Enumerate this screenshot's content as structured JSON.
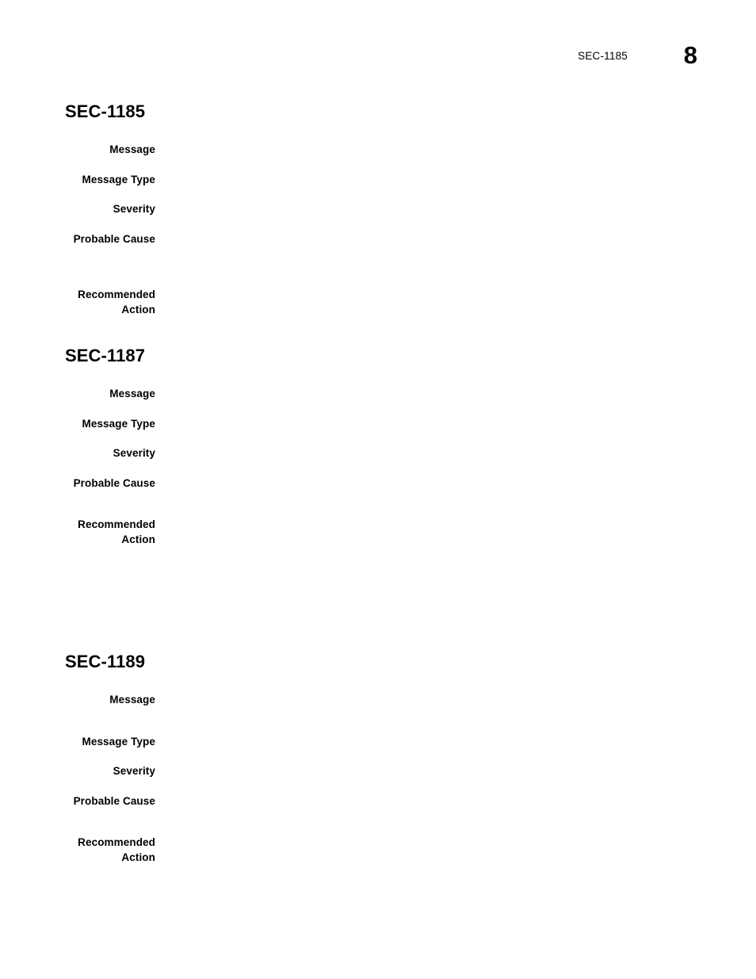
{
  "document": {
    "page_background": "#ffffff",
    "text_color": "#000000"
  },
  "header": {
    "chapter_label": "SEC-1185",
    "page_number": "8"
  },
  "field_labels": {
    "message": "Message",
    "message_type": "Message Type",
    "severity": "Severity",
    "probable_cause": "Probable Cause",
    "recommended_action": "Recommended\nAction"
  },
  "sections": [
    {
      "id": "sec-1185",
      "title": "SEC-1185",
      "fields": [
        {
          "label": "Message",
          "value": ""
        },
        {
          "label": "Message Type",
          "value": ""
        },
        {
          "label": "Severity",
          "value": ""
        },
        {
          "label": "Probable Cause",
          "value": ""
        },
        {
          "label": "Recommended\nAction",
          "value": ""
        }
      ]
    },
    {
      "id": "sec-1187",
      "title": "SEC-1187",
      "fields": [
        {
          "label": "Message",
          "value": ""
        },
        {
          "label": "Message Type",
          "value": ""
        },
        {
          "label": "Severity",
          "value": ""
        },
        {
          "label": "Probable Cause",
          "value": ""
        },
        {
          "label": "Recommended\nAction",
          "value": ""
        }
      ]
    },
    {
      "id": "sec-1189",
      "title": "SEC-1189",
      "fields": [
        {
          "label": "Message",
          "value": ""
        },
        {
          "label": "Message Type",
          "value": ""
        },
        {
          "label": "Severity",
          "value": ""
        },
        {
          "label": "Probable Cause",
          "value": ""
        },
        {
          "label": "Recommended\nAction",
          "value": ""
        }
      ]
    }
  ]
}
